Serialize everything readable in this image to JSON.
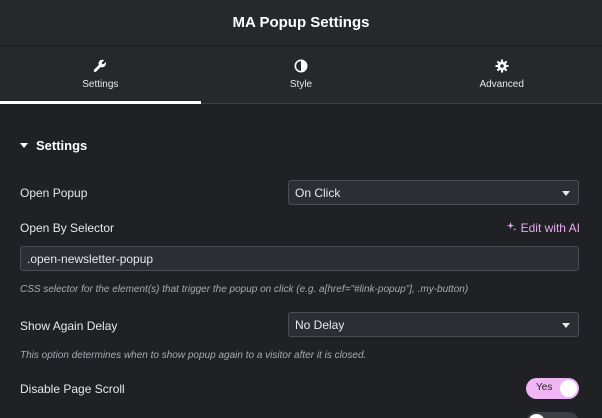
{
  "header": {
    "title": "MA Popup Settings"
  },
  "tabs": [
    {
      "label": "Settings",
      "icon": "wrench-icon",
      "active": true
    },
    {
      "label": "Style",
      "icon": "contrast-icon",
      "active": false
    },
    {
      "label": "Advanced",
      "icon": "gear-icon",
      "active": false
    }
  ],
  "section": {
    "title": "Settings"
  },
  "open_popup": {
    "label": "Open Popup",
    "value": "On Click"
  },
  "open_by_selector": {
    "label": "Open By Selector",
    "ai_link": "Edit with AI",
    "value": ".open-newsletter-popup",
    "help": "CSS selector for the element(s) that trigger the popup on click (e.g. a[href=\"#link-popup\"], .my-button)"
  },
  "show_again_delay": {
    "label": "Show Again Delay",
    "value": "No Delay",
    "help": "This option determines when to show popup again to a visitor after it is closed."
  },
  "disable_page_scroll": {
    "label": "Disable Page Scroll",
    "toggle_text": "Yes",
    "on": true
  },
  "colors": {
    "accent": "#f0b6f4",
    "ai_link": "#e9a9f0",
    "panel_bg": "#1f2124",
    "header_bg": "#26292c"
  }
}
